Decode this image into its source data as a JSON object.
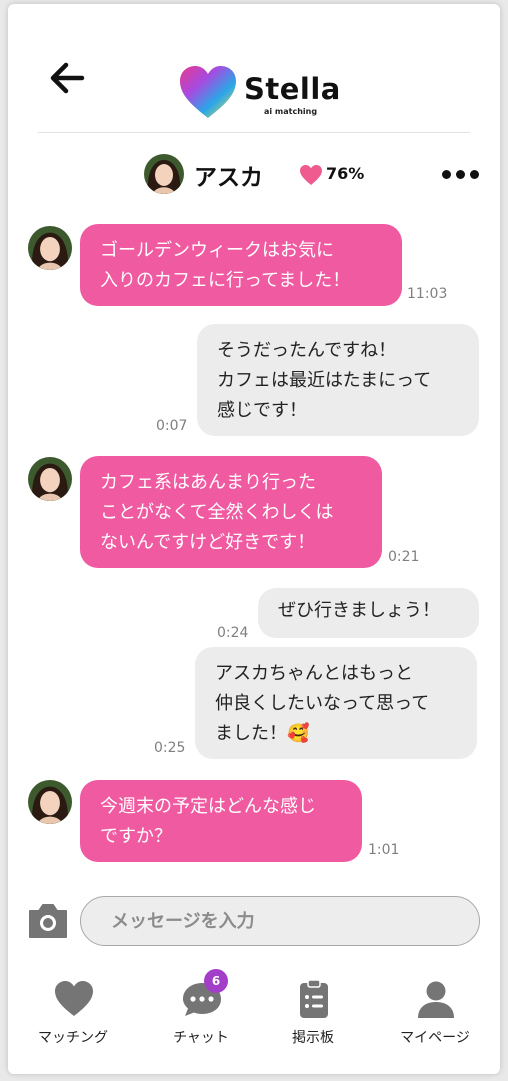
{
  "header": {
    "back_icon": "arrow-left-icon",
    "logo_text": "Stella",
    "logo_sub": "ai matching"
  },
  "profile": {
    "name": "アスカ",
    "match_percent": "76%",
    "match_icon": "heart-icon",
    "more_icon": "more-dots-icon"
  },
  "messages": [
    {
      "side": "in",
      "text": "ゴールデンウィークはお気に\n入りのカフェに行ってました！",
      "time": "11:03"
    },
    {
      "side": "out",
      "text": "そうだったんですね！\nカフェは最近はたまにって\n感じです！",
      "time": "0:07"
    },
    {
      "side": "in",
      "text": "カフェ系はあんまり行った\nことがなくて全然くわしくは\nないんですけど好きです！",
      "time": "0:21"
    },
    {
      "side": "out",
      "text": "ぜひ行きましょう！",
      "time": "0:24"
    },
    {
      "side": "out",
      "text": "アスカちゃんとはもっと\n仲良くしたいなって思って\nました！🥰",
      "time": "0:25"
    },
    {
      "side": "in",
      "text": "今週末の予定はどんな感じ\nですか？",
      "time": "1:01"
    }
  ],
  "composer": {
    "camera_icon": "camera-icon",
    "placeholder": "メッセージを入力"
  },
  "nav": {
    "items": [
      {
        "label": "マッチング",
        "icon": "heart-icon"
      },
      {
        "label": "チャット",
        "icon": "chat-bubble-icon",
        "badge": "6"
      },
      {
        "label": "掲示板",
        "icon": "clipboard-list-icon"
      },
      {
        "label": "マイページ",
        "icon": "user-icon"
      }
    ]
  },
  "colors": {
    "incoming_bubble": "#ef5aa0",
    "outgoing_bubble": "#ececec",
    "badge": "#a23ec7",
    "icon_gray": "#757575"
  }
}
